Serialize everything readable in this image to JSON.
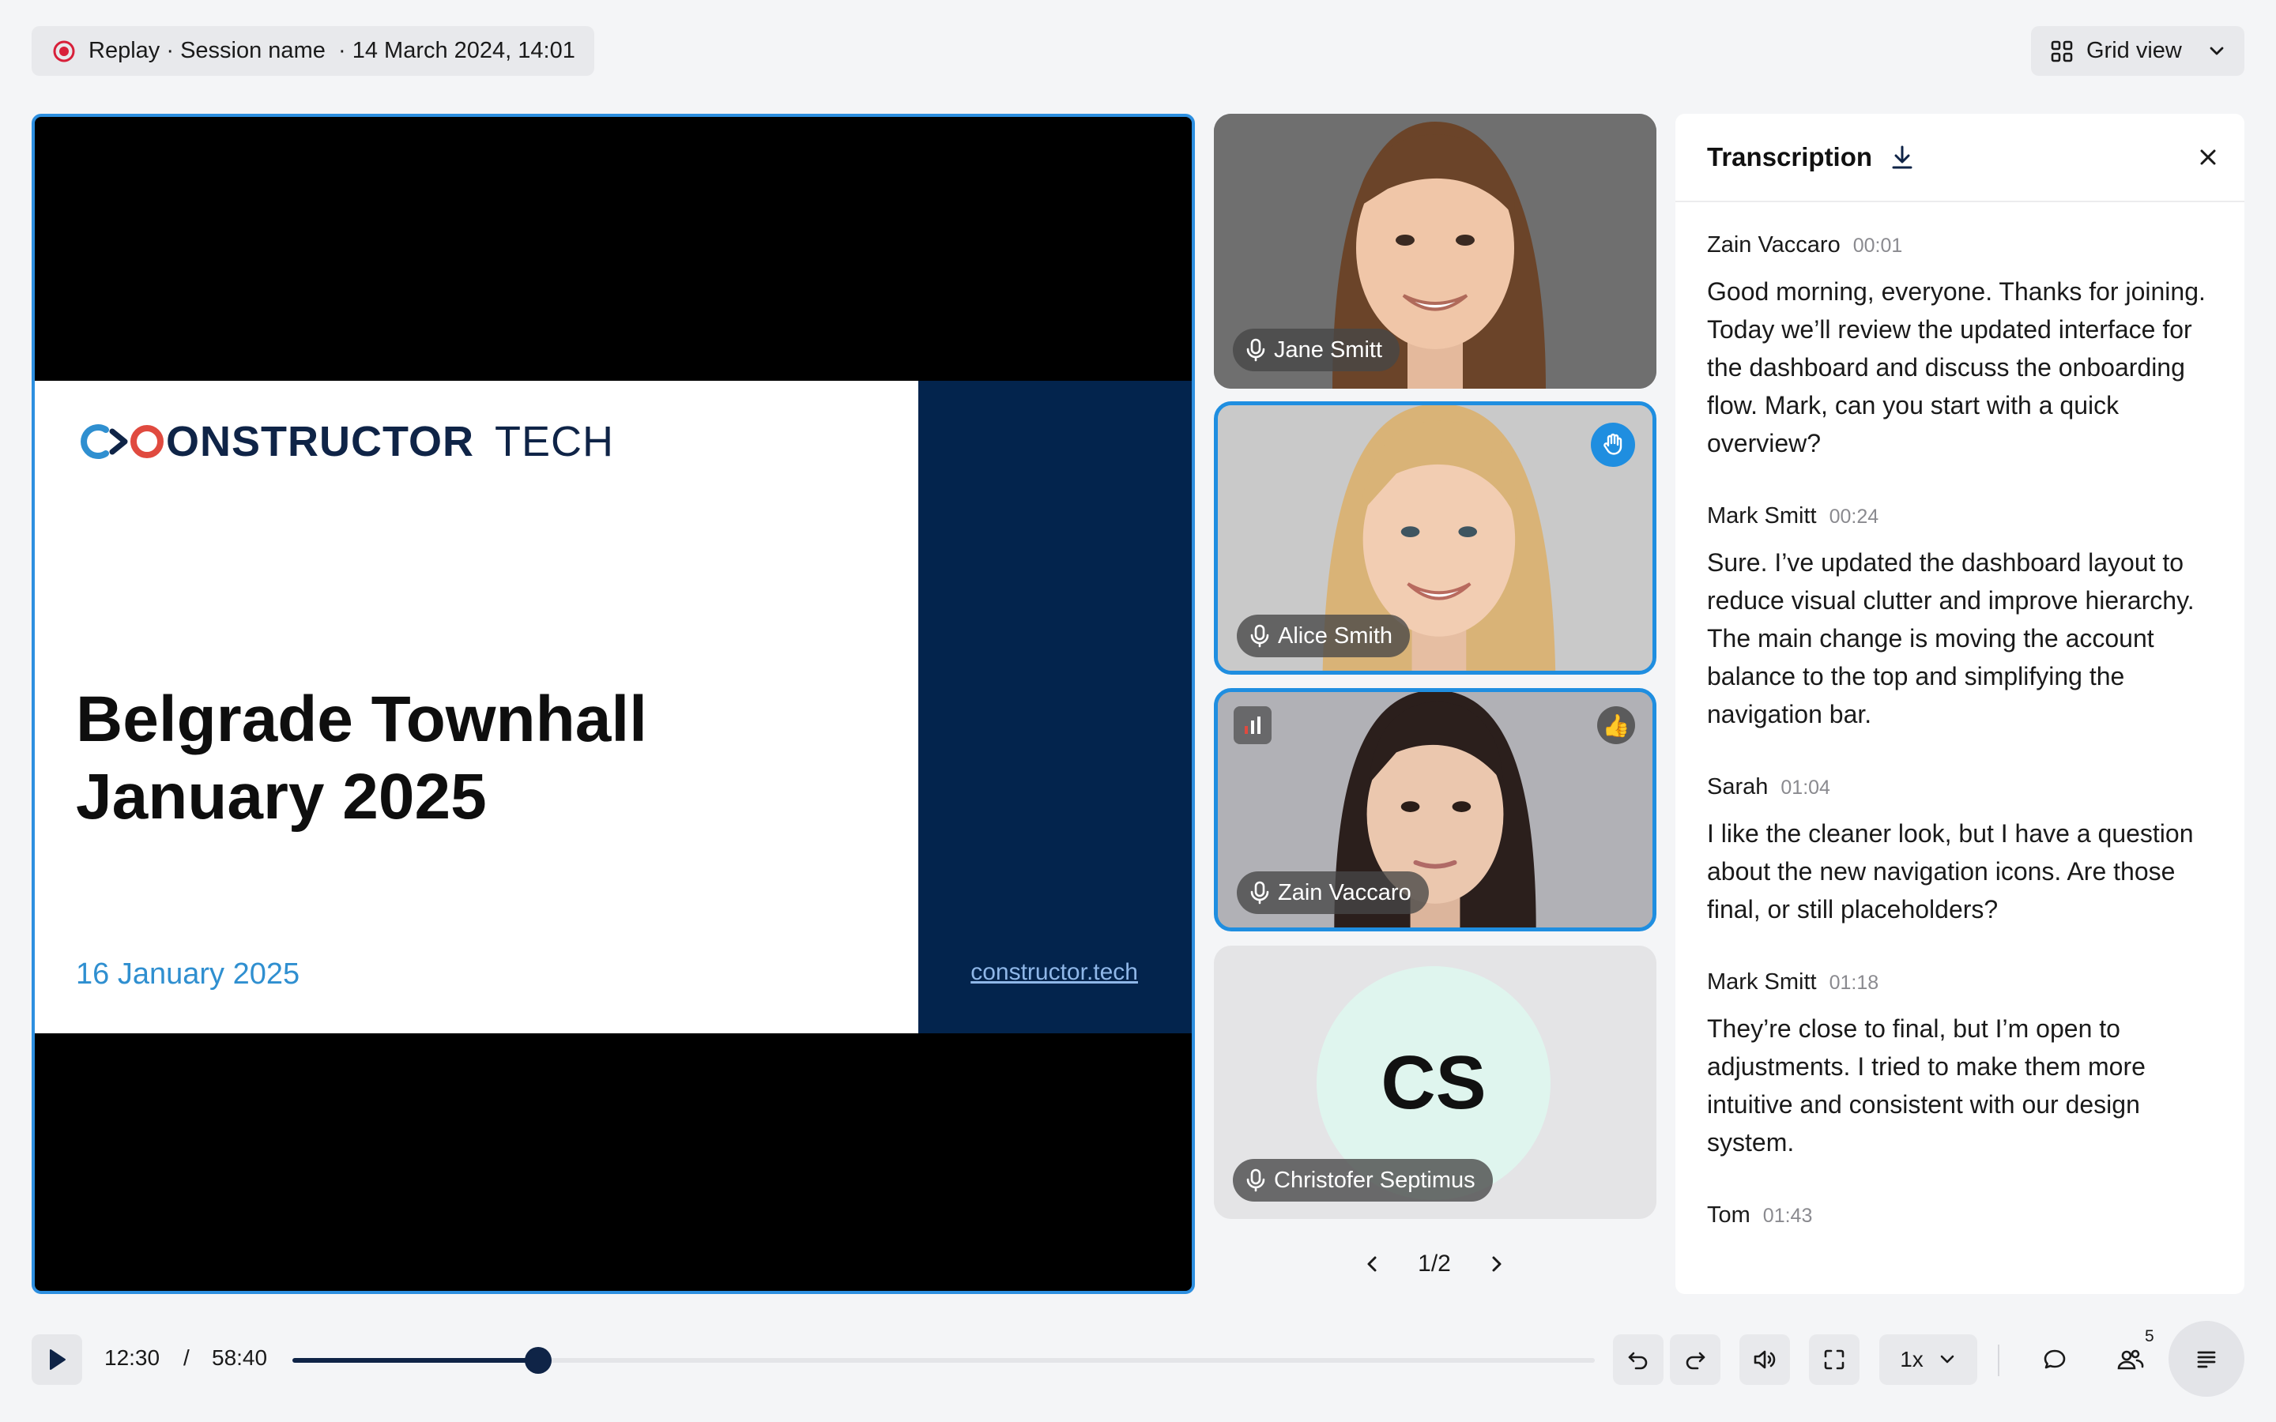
{
  "header": {
    "replay_label": "Replay",
    "session_name": "Session name",
    "session_date": "14 March 2024, 14:01",
    "view_label": "Grid view",
    "separator": "·"
  },
  "slide": {
    "brand_main": "ONSTRUCTOR",
    "brand_suffix": "TECH",
    "title_line1": "Belgrade Townhall",
    "title_line2": "January 2025",
    "date": "16 January 2025",
    "link": "constructor.tech",
    "colors": {
      "navy": "#03244d",
      "accent_blue": "#2f8fd0",
      "brand_red": "#e04a3f"
    }
  },
  "participants": [
    {
      "name": "Jane Smitt",
      "icon": "microphone-icon"
    },
    {
      "name": "Alice Smith",
      "icon": "microphone-icon",
      "raised_hand": true
    },
    {
      "name": "Zain Vaccaro",
      "icon": "microphone-icon",
      "reaction": "👍"
    },
    {
      "name": "Christofer Septimus",
      "initials": "CS",
      "icon": "microphone-icon"
    }
  ],
  "pager": {
    "label": "1/2"
  },
  "transcription": {
    "title": "Transcription",
    "entries": [
      {
        "speaker": "Zain Vaccaro",
        "time": "00:01",
        "text": "Good morning, everyone. Thanks for joining. Today we’ll review the updated interface for the dashboard and discuss the onboarding flow. Mark, can you start with a quick overview?"
      },
      {
        "speaker": "Mark Smitt",
        "time": "00:24",
        "text": "Sure. I’ve updated the dashboard layout to reduce visual clutter and improve hierarchy. The main change is moving the account balance to the top and simplifying the navigation bar."
      },
      {
        "speaker": "Sarah",
        "time": "01:04",
        "text": "I like the cleaner look, but I have a question about the new navigation icons. Are those final, or still placeholders?"
      },
      {
        "speaker": "Mark Smitt",
        "time": "01:18",
        "text": "They’re close to final, but I’m open to adjustments. I tried to make them more intuitive and consistent with our design system."
      },
      {
        "speaker": "Tom",
        "time": "01:43",
        "text": ""
      }
    ]
  },
  "player": {
    "current_time": "12:30",
    "time_separator": "/",
    "total_time": "58:40",
    "progress_fraction": 0.189,
    "speed": "1x",
    "participants_count": "5"
  }
}
